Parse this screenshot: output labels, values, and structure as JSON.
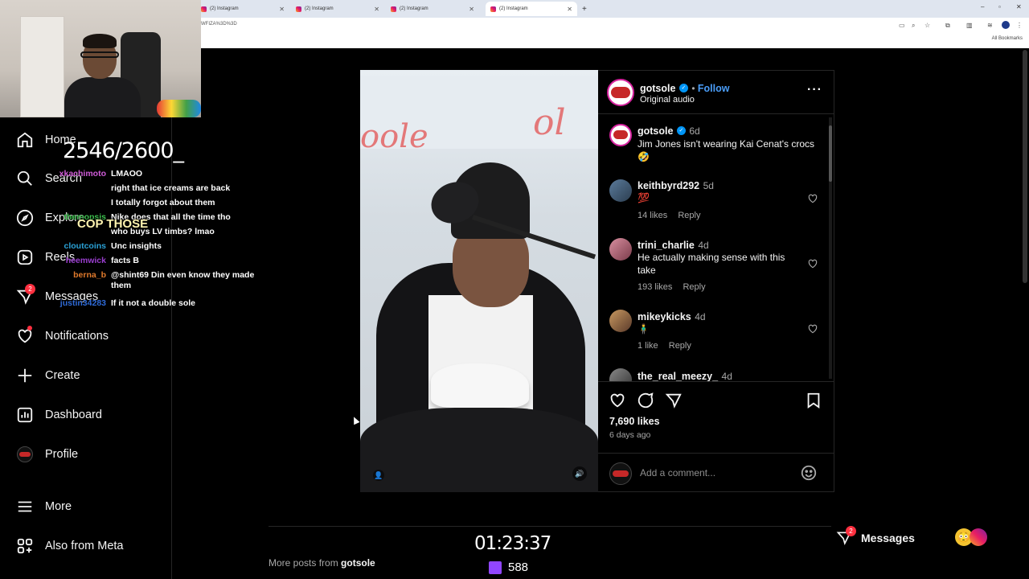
{
  "browser": {
    "tabs": [
      {
        "title": "(2) Instagram"
      },
      {
        "title": "(2) Instagram"
      },
      {
        "title": "(2) Instagram"
      },
      {
        "title": "(2) Instagram"
      }
    ],
    "url_fragment": "WFIZA%3D%3D",
    "bookmarks_label": "All Bookmarks"
  },
  "sidebar": {
    "items": [
      {
        "label": "Home",
        "icon": "home-icon"
      },
      {
        "label": "Search",
        "icon": "search-icon"
      },
      {
        "label": "Explore",
        "icon": "compass-icon"
      },
      {
        "label": "Reels",
        "icon": "reels-icon"
      },
      {
        "label": "Messages",
        "icon": "send-icon",
        "badge": "2"
      },
      {
        "label": "Notifications",
        "icon": "heart-icon"
      },
      {
        "label": "Create",
        "icon": "plus-icon"
      },
      {
        "label": "Dashboard",
        "icon": "dashboard-icon"
      },
      {
        "label": "Profile",
        "icon": "profile-avatar"
      },
      {
        "label": "More",
        "icon": "menu-icon"
      },
      {
        "label": "Also from Meta",
        "icon": "meta-icon"
      }
    ]
  },
  "stream": {
    "counter": "2546/2600_",
    "timer": "01:23:37",
    "viewers": "588",
    "chat": [
      {
        "user": "xkachimoto",
        "color": "#d05cd8",
        "msg": "LMAOO"
      },
      {
        "user": "",
        "color": "#5a3fd0",
        "msg": "right that ice creams are back"
      },
      {
        "user": "",
        "color": "#5a3fd0",
        "msg": "I totally forgot about them"
      },
      {
        "user": "themopsis",
        "color": "#3ec34f",
        "msg": "Nike does that all the time tho"
      },
      {
        "user": "",
        "color": "#5a3fd0",
        "msg": "who buys LV timbs? lmao"
      },
      {
        "user": "cloutcoins",
        "color": "#2aa1d6",
        "msg": "Unc insights"
      },
      {
        "user": "heemwick",
        "color": "#9b3fd0",
        "msg": "facts B"
      },
      {
        "user": "berna_b",
        "color": "#e07a2c",
        "msg": "@shint69 Din even know they made them"
      },
      {
        "user": "justin34283",
        "color": "#2f6bd8",
        "msg": "If it not a double sole"
      }
    ]
  },
  "post": {
    "caption_overlay": "COP THOSE",
    "author": "gotsole",
    "follow_label": "Follow",
    "audio": "Original audio",
    "likes": "7,690 likes",
    "posted": "6 days ago",
    "comment_placeholder": "Add a comment...",
    "comments": [
      {
        "user": "gotsole",
        "time": "6d",
        "text": "Jim Jones isn't wearing Kai Cenat's crocs 🤣",
        "verified": true
      },
      {
        "user": "keithbyrd292",
        "time": "5d",
        "text": "💯",
        "likes": "14 likes",
        "reply": "Reply"
      },
      {
        "user": "trini_charlie",
        "time": "4d",
        "text": "He actually making sense with this take",
        "likes": "193 likes",
        "reply": "Reply"
      },
      {
        "user": "mikeykicks",
        "time": "4d",
        "text": "🧍‍♂️",
        "likes": "1 like",
        "reply": "Reply"
      },
      {
        "user": "the_real_meezy_",
        "time": "4d",
        "text": ""
      }
    ]
  },
  "footer": {
    "more_posts_prefix": "More posts from",
    "more_posts_user": "gotsole",
    "messages_label": "Messages",
    "messages_badge": "2"
  }
}
